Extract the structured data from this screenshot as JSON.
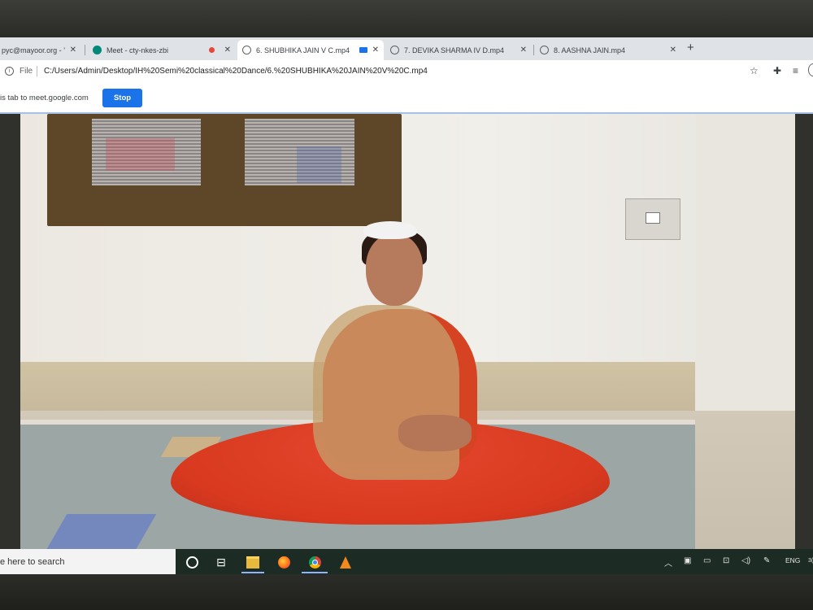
{
  "browser": {
    "tabs": [
      {
        "label": "pyc@mayoor.org - ’",
        "icon": "gmail-icon"
      },
      {
        "label": "Meet - cty-nkes-zbi",
        "icon": "meet-icon"
      },
      {
        "label": "6. SHUBHIKA JAIN V C.mp4",
        "icon": "globe-icon"
      },
      {
        "label": "7. DEVIKA SHARMA IV D.mp4",
        "icon": "globe-icon"
      },
      {
        "label": "8. AASHNA JAIN.mp4",
        "icon": "globe-icon"
      }
    ],
    "active_tab_index": 2,
    "new_tab_symbol": "+",
    "close_symbol": "✕",
    "address": {
      "scheme_label": "File",
      "url": "C:/Users/Admin/Desktop/IH%20Semi%20classical%20Dance/6.%20SHUBHIKA%20JAIN%20V%20C.mp4"
    },
    "sharebar": {
      "text": "is tab to meet.google.com",
      "stop_label": "Stop"
    }
  },
  "taskbar": {
    "search_placeholder": "e here to search",
    "language": "ENG",
    "clock_partial": "3("
  },
  "colors": {
    "accent": "#1a73e8",
    "taskbar": "#1c2b24",
    "dress": "#d8391f"
  }
}
